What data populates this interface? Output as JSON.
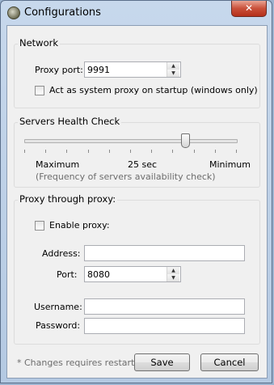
{
  "window": {
    "title": "Configurations",
    "close_glyph": "✕"
  },
  "network": {
    "title": "Network",
    "proxy_port_label": "Proxy port:",
    "proxy_port_value": "9991",
    "system_proxy_label": "Act as system proxy on startup (windows only)",
    "system_proxy_checked": false
  },
  "health": {
    "title": "Servers Health Check",
    "slider_level": 0.76,
    "left_label": "Maximum",
    "value_label": "25 sec",
    "right_label": "Minimum",
    "hint": "(Frequency of servers availability check)"
  },
  "proxy_chain": {
    "title": "Proxy through proxy:",
    "enable_label": "Enable proxy:",
    "enable_checked": false,
    "address_label": "Address:",
    "address_value": "",
    "port_label": "Port:",
    "port_value": "8080",
    "username_label": "Username:",
    "username_value": "",
    "password_label": "Password:",
    "password_value": ""
  },
  "footer": {
    "note": "* Changes requires restart",
    "save_label": "Save",
    "cancel_label": "Cancel"
  },
  "icons": {
    "app": "app-icon",
    "close": "close-icon",
    "spin_up": "spin-up-icon",
    "spin_down": "spin-down-icon"
  }
}
